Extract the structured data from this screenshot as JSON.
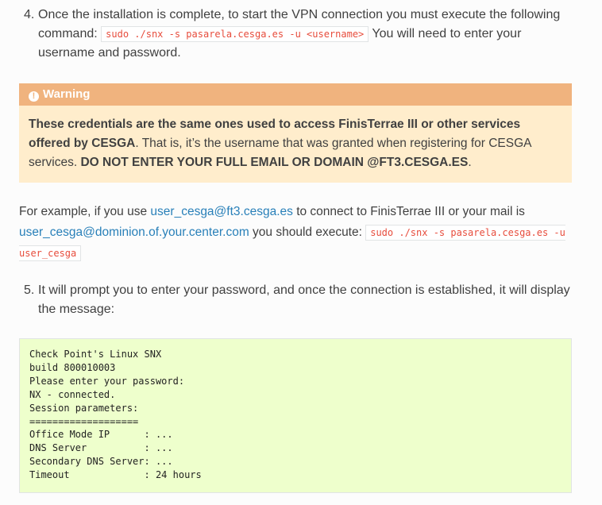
{
  "step4": {
    "number": "4.",
    "text_before": "Once the installation is complete, to start the VPN connection you must execute the following command:",
    "code": "sudo ./snx -s pasarela.cesga.es -u <username>",
    "text_after": "You will need to enter your username and password."
  },
  "warning": {
    "icon": "exclamation-circle-icon",
    "title": "Warning",
    "bold1": "These credentials are the same ones used to access FinisTerrae III or other services offered by CESGA",
    "text": ". That is, it’s the username that was granted when registering for CESGA services.",
    "bold2": "DO NOT ENTER YOUR FULL EMAIL OR DOMAIN @FT3.CESGA.ES",
    "end": "."
  },
  "example": {
    "t1": "For example, if you use",
    "link1": "user_cesga@ft3.cesga.es",
    "t2": "to connect to FinisTerrae III or your mail is",
    "link2": "user_cesga@dominion.of.your.center.com",
    "t3": "you should execute:",
    "code": "sudo ./snx -s pasarela.cesga.es -u user_cesga"
  },
  "step5": {
    "number": "5.",
    "text": "It will prompt you to enter your password, and once the connection is established, it will display the message:"
  },
  "terminal": {
    "output": "Check Point's Linux SNX\nbuild 800010003\nPlease enter your password:\nNX - connected.\nSession parameters:\n===================\nOffice Mode IP      : ...\nDNS Server          : ...\nSecondary DNS Server: ...\nTimeout             : 24 hours"
  }
}
